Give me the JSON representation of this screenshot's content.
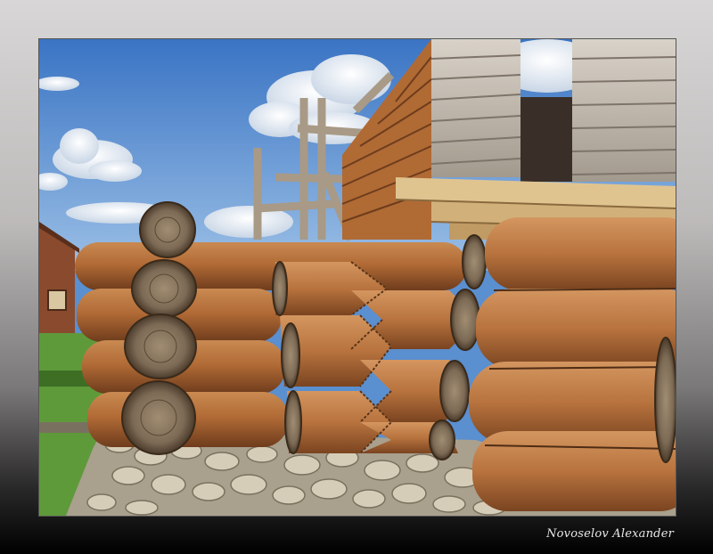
{
  "caption": {
    "author": "Novoselov Alexander"
  },
  "colors": {
    "sky_top": "#3f79c6",
    "sky_bottom": "#8fb7e3",
    "log": "#b8703a",
    "log_dark": "#7a4420",
    "cut_end": "#8a7a66",
    "stone": "#c8bfae",
    "grass": "#5e9a3a"
  }
}
